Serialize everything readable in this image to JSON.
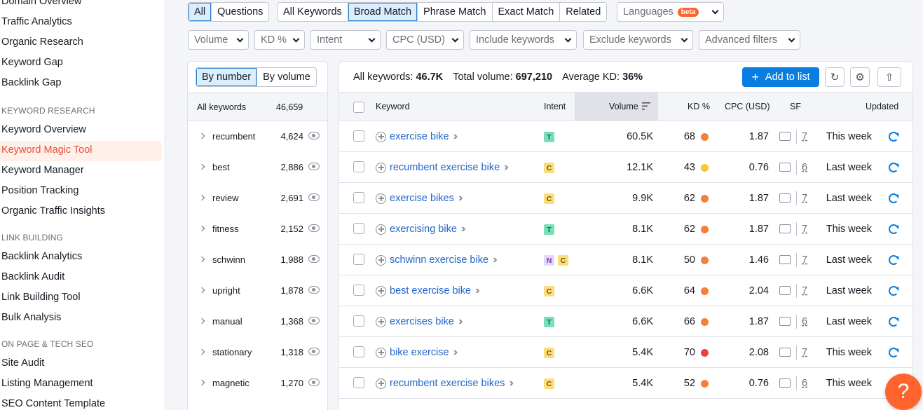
{
  "sidebar": {
    "items_top": [
      "Domain Overview",
      "Traffic Analytics",
      "Organic Research",
      "Keyword Gap",
      "Backlink Gap"
    ],
    "section_keyword": "KEYWORD RESEARCH",
    "items_keyword": [
      "Keyword Overview",
      "Keyword Magic Tool",
      "Keyword Manager",
      "Position Tracking",
      "Organic Traffic Insights"
    ],
    "active_item": "Keyword Magic Tool",
    "section_link": "LINK BUILDING",
    "items_link": [
      "Backlink Analytics",
      "Backlink Audit",
      "Link Building Tool",
      "Bulk Analysis"
    ],
    "section_onpage": "ON PAGE & TECH SEO",
    "items_onpage": [
      "Site Audit",
      "Listing Management",
      "SEO Content Template"
    ]
  },
  "filters": {
    "questions_toggle": [
      "All",
      "Questions"
    ],
    "match_types": [
      "All Keywords",
      "Broad Match",
      "Phrase Match",
      "Exact Match",
      "Related"
    ],
    "selected_match": "Broad Match",
    "languages": "Languages",
    "beta": "beta",
    "dropdowns": [
      "Volume",
      "KD %",
      "Intent",
      "CPC (USD)",
      "Include keywords",
      "Exclude keywords",
      "Advanced filters"
    ]
  },
  "groups": {
    "toggle": [
      "By number",
      "By volume"
    ],
    "all_label": "All keywords",
    "all_count": "46,659",
    "items": [
      {
        "name": "recumbent",
        "count": "4,624"
      },
      {
        "name": "best",
        "count": "2,886"
      },
      {
        "name": "review",
        "count": "2,691"
      },
      {
        "name": "fitness",
        "count": "2,152"
      },
      {
        "name": "schwinn",
        "count": "1,988"
      },
      {
        "name": "upright",
        "count": "1,878"
      },
      {
        "name": "manual",
        "count": "1,368"
      },
      {
        "name": "stationary",
        "count": "1,318"
      },
      {
        "name": "magnetic",
        "count": "1,270"
      }
    ]
  },
  "summary": {
    "all_label": "All keywords:",
    "all_value": "46.7K",
    "vol_label": "Total volume:",
    "vol_value": "697,210",
    "kd_label": "Average KD:",
    "kd_value": "36%",
    "add_to_list": "Add to list"
  },
  "table": {
    "headers": {
      "keyword": "Keyword",
      "intent": "Intent",
      "volume": "Volume",
      "kd": "KD %",
      "cpc": "CPC (USD)",
      "sf": "SF",
      "updated": "Updated"
    },
    "rows": [
      {
        "keyword": "exercise bike",
        "intent": [
          "T"
        ],
        "volume": "60.5K",
        "kd": "68",
        "kd_color": "#f4803a",
        "cpc": "1.87",
        "sf": "7",
        "updated": "This week"
      },
      {
        "keyword": "recumbent exercise bike",
        "intent": [
          "C"
        ],
        "volume": "12.1K",
        "kd": "43",
        "kd_color": "#f9c62b",
        "cpc": "0.76",
        "sf": "6",
        "updated": "Last week"
      },
      {
        "keyword": "exercise bikes",
        "intent": [
          "C"
        ],
        "volume": "9.9K",
        "kd": "62",
        "kd_color": "#f4803a",
        "cpc": "1.87",
        "sf": "7",
        "updated": "Last week"
      },
      {
        "keyword": "exercising bike",
        "intent": [
          "T"
        ],
        "volume": "8.1K",
        "kd": "62",
        "kd_color": "#f4803a",
        "cpc": "1.87",
        "sf": "7",
        "updated": "This week"
      },
      {
        "keyword": "schwinn exercise bike",
        "intent": [
          "N",
          "C"
        ],
        "volume": "8.1K",
        "kd": "50",
        "kd_color": "#f4803a",
        "cpc": "1.46",
        "sf": "7",
        "updated": "Last week"
      },
      {
        "keyword": "best exercise bike",
        "intent": [
          "C"
        ],
        "volume": "6.6K",
        "kd": "64",
        "kd_color": "#f4803a",
        "cpc": "2.04",
        "sf": "7",
        "updated": "Last week"
      },
      {
        "keyword": "exercises bike",
        "intent": [
          "T"
        ],
        "volume": "6.6K",
        "kd": "66",
        "kd_color": "#f4803a",
        "cpc": "1.87",
        "sf": "6",
        "updated": "Last week"
      },
      {
        "keyword": "bike exercise",
        "intent": [
          "C"
        ],
        "volume": "5.4K",
        "kd": "70",
        "kd_color": "#ee3d45",
        "cpc": "2.08",
        "sf": "7",
        "updated": "This week"
      },
      {
        "keyword": "recumbent exercise bikes",
        "intent": [
          "C"
        ],
        "volume": "5.4K",
        "kd": "52",
        "kd_color": "#f4803a",
        "cpc": "0.76",
        "sf": "6",
        "updated": "This week"
      }
    ]
  },
  "help": "?"
}
